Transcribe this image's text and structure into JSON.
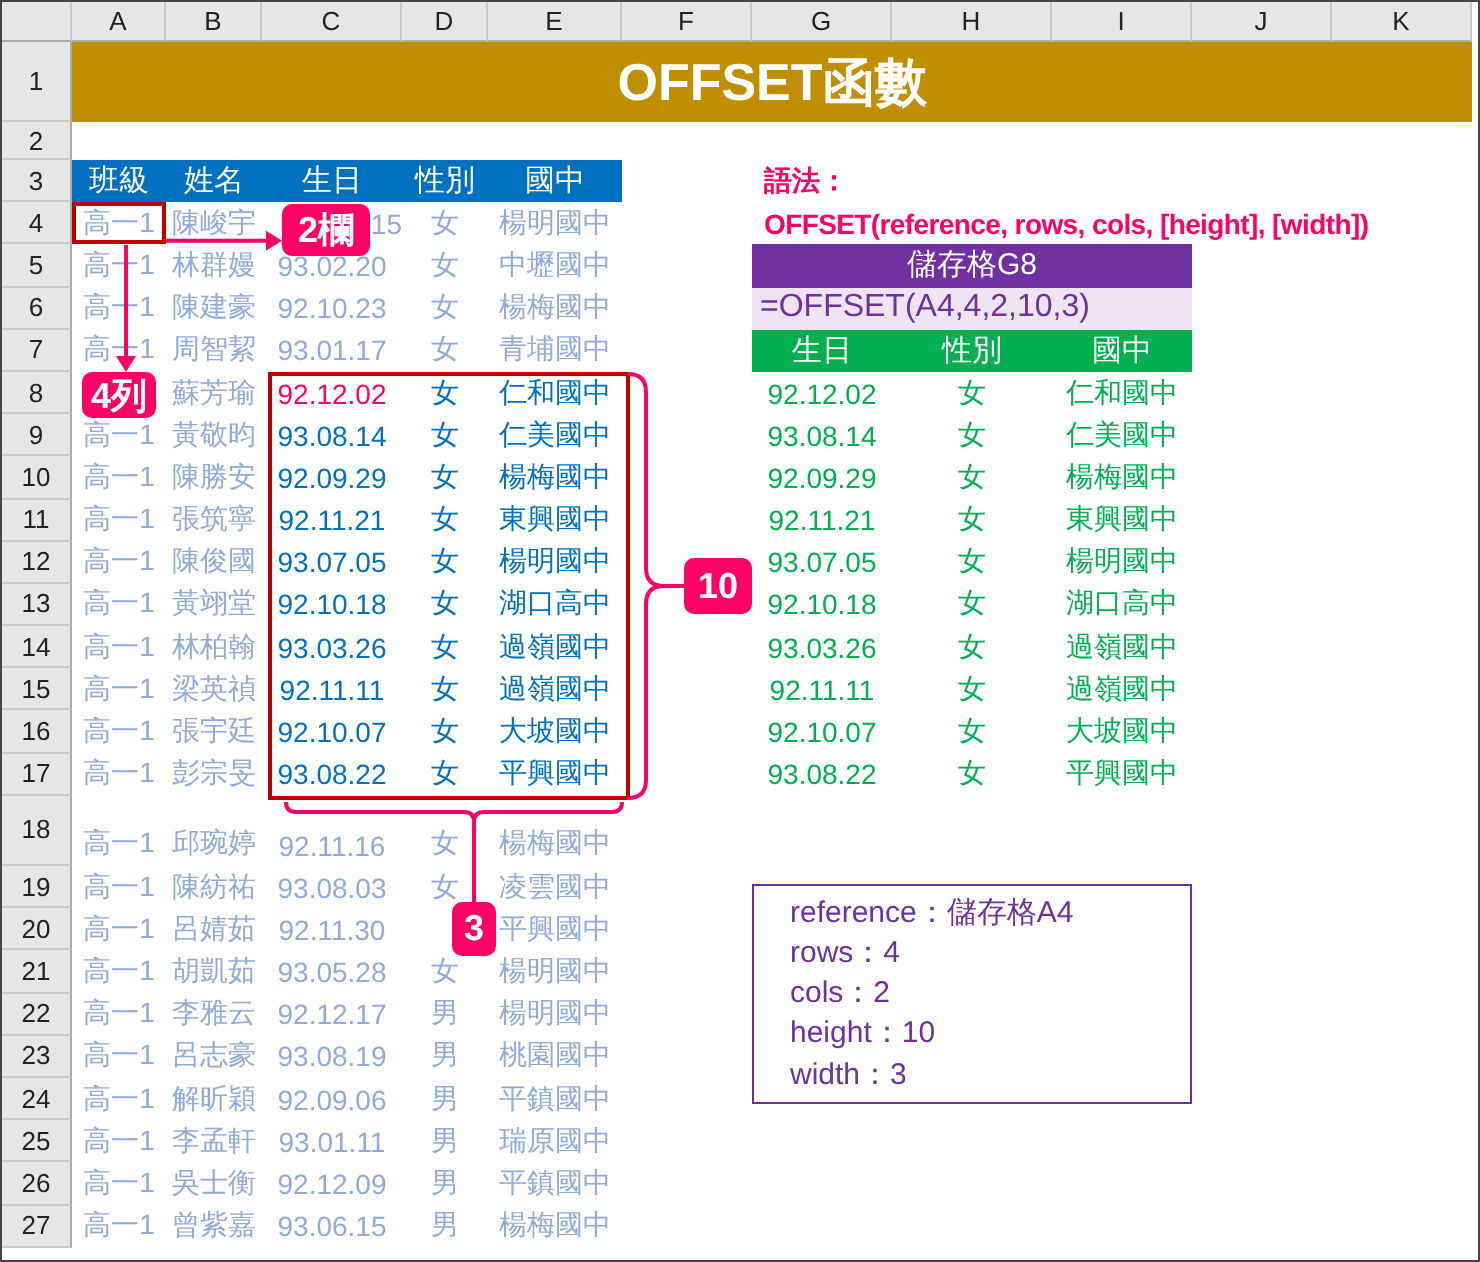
{
  "column_letters": [
    "A",
    "B",
    "C",
    "D",
    "E",
    "F",
    "G",
    "H",
    "I",
    "J",
    "K"
  ],
  "row_numbers": [
    "1",
    "2",
    "3",
    "4",
    "5",
    "6",
    "7",
    "8",
    "9",
    "10",
    "11",
    "12",
    "13",
    "14",
    "15",
    "16",
    "17",
    "18",
    "19",
    "20",
    "21",
    "22",
    "23",
    "24",
    "25",
    "26",
    "27"
  ],
  "title": "OFFSET函數",
  "table": {
    "columns": [
      "班級",
      "姓名",
      "生日",
      "性別",
      "國中"
    ],
    "rows": [
      {
        "kind": "reference",
        "class": "高一1",
        "name": "陳峻宇",
        "birthday": "15",
        "gender": "女",
        "school": "楊明國中"
      },
      {
        "kind": "plain",
        "class": "高一1",
        "name": "林群嫚",
        "birthday": "93.02.20",
        "gender": "女",
        "school": "中壢國中"
      },
      {
        "kind": "plain",
        "class": "高一1",
        "name": "陳建豪",
        "birthday": "92.10.23",
        "gender": "女",
        "school": "楊梅國中"
      },
      {
        "kind": "plain",
        "class": "高一1",
        "name": "周智絜",
        "birthday": "93.01.17",
        "gender": "女",
        "school": "青埔國中"
      },
      {
        "kind": "range_start",
        "name": "蘇芳瑜",
        "birthday": "92.12.02",
        "gender": "女",
        "school": "仁和國中"
      },
      {
        "kind": "range",
        "class": "高一1",
        "name": "黃敬昀",
        "birthday": "93.08.14",
        "gender": "女",
        "school": "仁美國中"
      },
      {
        "kind": "range",
        "class": "高一1",
        "name": "陳勝安",
        "birthday": "92.09.29",
        "gender": "女",
        "school": "楊梅國中"
      },
      {
        "kind": "range",
        "class": "高一1",
        "name": "張筑寧",
        "birthday": "92.11.21",
        "gender": "女",
        "school": "東興國中"
      },
      {
        "kind": "range",
        "class": "高一1",
        "name": "陳俊國",
        "birthday": "93.07.05",
        "gender": "女",
        "school": "楊明國中"
      },
      {
        "kind": "range",
        "class": "高一1",
        "name": "黃翊堂",
        "birthday": "92.10.18",
        "gender": "女",
        "school": "湖口高中"
      },
      {
        "kind": "range",
        "class": "高一1",
        "name": "林柏翰",
        "birthday": "93.03.26",
        "gender": "女",
        "school": "過嶺國中"
      },
      {
        "kind": "range",
        "class": "高一1",
        "name": "梁英禎",
        "birthday": "92.11.11",
        "gender": "女",
        "school": "過嶺國中"
      },
      {
        "kind": "range",
        "class": "高一1",
        "name": "張宇廷",
        "birthday": "92.10.07",
        "gender": "女",
        "school": "大坡國中"
      },
      {
        "kind": "range",
        "class": "高一1",
        "name": "彭宗旻",
        "birthday": "93.08.22",
        "gender": "女",
        "school": "平興國中"
      },
      {
        "kind": "plain",
        "class": "高一1",
        "name": "邱琬婷",
        "birthday": "92.11.16",
        "gender": "女",
        "school": "楊梅國中"
      },
      {
        "kind": "plain",
        "class": "高一1",
        "name": "陳紡祐",
        "birthday": "93.08.03",
        "gender": "女",
        "school": "凌雲國中"
      },
      {
        "kind": "plain",
        "class": "高一1",
        "name": "呂婧茹",
        "birthday": "92.11.30",
        "school": "平興國中"
      },
      {
        "kind": "plain",
        "class": "高一1",
        "name": "胡凱茹",
        "birthday": "93.05.28",
        "gender": "女",
        "school": "楊明國中"
      },
      {
        "kind": "plain",
        "class": "高一1",
        "name": "李雅云",
        "birthday": "92.12.17",
        "gender": "男",
        "school": "楊明國中"
      },
      {
        "kind": "plain",
        "class": "高一1",
        "name": "呂志豪",
        "birthday": "93.08.19",
        "gender": "男",
        "school": "桃園國中"
      },
      {
        "kind": "plain",
        "class": "高一1",
        "name": "解昕穎",
        "birthday": "92.09.06",
        "gender": "男",
        "school": "平鎮國中"
      },
      {
        "kind": "plain",
        "class": "高一1",
        "name": "李孟軒",
        "birthday": "93.01.11",
        "gender": "男",
        "school": "瑞原國中"
      },
      {
        "kind": "plain",
        "class": "高一1",
        "name": "吳士衡",
        "birthday": "92.12.09",
        "gender": "男",
        "school": "平鎮國中"
      },
      {
        "kind": "plain",
        "class": "高一1",
        "name": "曾紫嘉",
        "birthday": "93.06.15",
        "gender": "男",
        "school": "楊梅國中"
      }
    ]
  },
  "syntax": {
    "label": "語法：",
    "formula": "OFFSET(reference, rows, cols, [height], [width])"
  },
  "result": {
    "title": "儲存格G8",
    "formula": "=OFFSET(A4,4,2,10,3)",
    "columns": [
      "生日",
      "性別",
      "國中"
    ],
    "rows": [
      {
        "birthday": "92.12.02",
        "gender": "女",
        "school": "仁和國中"
      },
      {
        "birthday": "93.08.14",
        "gender": "女",
        "school": "仁美國中"
      },
      {
        "birthday": "92.09.29",
        "gender": "女",
        "school": "楊梅國中"
      },
      {
        "birthday": "92.11.21",
        "gender": "女",
        "school": "東興國中"
      },
      {
        "birthday": "93.07.05",
        "gender": "女",
        "school": "楊明國中"
      },
      {
        "birthday": "92.10.18",
        "gender": "女",
        "school": "湖口高中"
      },
      {
        "birthday": "93.03.26",
        "gender": "女",
        "school": "過嶺國中"
      },
      {
        "birthday": "92.11.11",
        "gender": "女",
        "school": "過嶺國中"
      },
      {
        "birthday": "92.10.07",
        "gender": "女",
        "school": "大坡國中"
      },
      {
        "birthday": "93.08.22",
        "gender": "女",
        "school": "平興國中"
      }
    ]
  },
  "arguments": [
    "reference：儲存格A4",
    "rows：4",
    "cols：2",
    "height：10",
    "width：3"
  ],
  "callouts": [
    {
      "kind": "cols",
      "text": "2欄"
    },
    {
      "kind": "rows",
      "text": "4列"
    },
    {
      "kind": "height",
      "text": "10"
    },
    {
      "kind": "width",
      "text": "3"
    }
  ]
}
